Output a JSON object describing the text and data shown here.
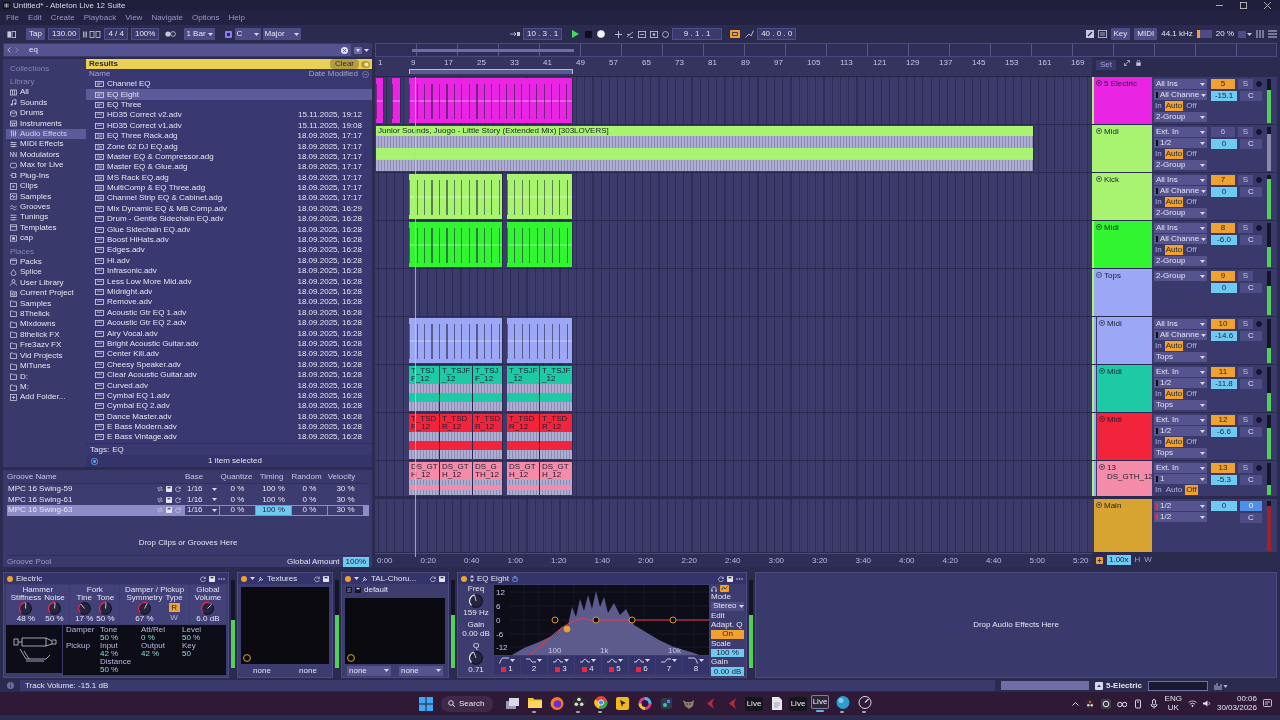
{
  "window": {
    "title": "Untitled* - Ableton Live 12 Suite"
  },
  "menu": [
    "File",
    "Edit",
    "Create",
    "Playback",
    "View",
    "Navigate",
    "Options",
    "Help"
  ],
  "control_bar": {
    "tap": "Tap",
    "tempo": "130.00",
    "signature": "4 / 4",
    "zoom": "100%",
    "quantization": "1 Bar",
    "key": "C",
    "scale": "Major",
    "position": "10 . 3 . 1",
    "playing": true,
    "loop_start": "9 . 1 . 1",
    "loop_on": true,
    "loop_length": "40 . 0 . 0",
    "key_button": "Key",
    "midi_button": "MIDI",
    "sample_rate": "44.1 kHz",
    "cpu": {
      "reading": "20 %",
      "level": 0.2
    }
  },
  "browser": {
    "search": "eq",
    "sidebar": [
      {
        "heading": "Collections"
      },
      {
        "heading": "Library",
        "items": [
          {
            "label": "All",
            "kind": "grid",
            "selected": false
          },
          {
            "label": "Sounds",
            "kind": "note",
            "selected": false
          },
          {
            "label": "Drums",
            "kind": "drum",
            "selected": false
          },
          {
            "label": "Instruments",
            "kind": "keys",
            "selected": false
          },
          {
            "label": "Audio Effects",
            "kind": "sliders",
            "selected": true
          },
          {
            "label": "MIDI Effects",
            "kind": "midi",
            "selected": false
          },
          {
            "label": "Modulators",
            "kind": "wave",
            "selected": false
          },
          {
            "label": "Max for Live",
            "kind": "m4l",
            "selected": false
          },
          {
            "label": "Plug-Ins",
            "kind": "plug",
            "selected": false
          },
          {
            "label": "Clips",
            "kind": "clip",
            "selected": false
          },
          {
            "label": "Samples",
            "kind": "sample",
            "selected": false
          },
          {
            "label": "Grooves",
            "kind": "groove",
            "selected": false
          },
          {
            "label": "Tunings",
            "kind": "tuning",
            "selected": false
          },
          {
            "label": "Templates",
            "kind": "template",
            "selected": false
          },
          {
            "label": "cap",
            "kind": "box",
            "selected": false
          }
        ]
      },
      {
        "heading": "Places",
        "items": [
          {
            "label": "Packs",
            "kind": "pack",
            "selected": false
          },
          {
            "label": "Splice",
            "kind": "splice",
            "selected": false
          },
          {
            "label": "User Library",
            "kind": "user",
            "selected": false
          },
          {
            "label": "Current Project",
            "kind": "project",
            "selected": false
          },
          {
            "label": "Samples",
            "kind": "folder",
            "selected": false
          },
          {
            "label": "8Thelick",
            "kind": "folder",
            "selected": false
          },
          {
            "label": "Mixdowns",
            "kind": "folder",
            "selected": false
          },
          {
            "label": "8thelick FX",
            "kind": "folder",
            "selected": false
          },
          {
            "label": "Fre3azv FX",
            "kind": "folder",
            "selected": false
          },
          {
            "label": "Vid Projects",
            "kind": "folder",
            "selected": false
          },
          {
            "label": "MiTunes",
            "kind": "folder",
            "selected": false
          },
          {
            "label": "D:",
            "kind": "folder",
            "selected": false
          },
          {
            "label": "M:",
            "kind": "folder",
            "selected": false
          },
          {
            "label": "Add Folder...",
            "kind": "add",
            "selected": false
          }
        ]
      }
    ],
    "results": {
      "title": "Results",
      "clear": "Clear",
      "columns": [
        "Name",
        "Date Modified"
      ],
      "rows": [
        {
          "name": "Channel EQ",
          "kind": "device",
          "selected": false
        },
        {
          "name": "EQ Eight",
          "kind": "device",
          "selected": true
        },
        {
          "name": "EQ Three",
          "kind": "device",
          "selected": false
        },
        {
          "name": "HD35 Correct v2.adv",
          "kind": "preset",
          "date": "15.11.2025, 19:12",
          "selected": false
        },
        {
          "name": "HD35 Correct v1.adv",
          "kind": "preset",
          "date": "15.11.2025, 19:08",
          "selected": false
        },
        {
          "name": "EQ Three Rack.adg",
          "kind": "rack",
          "date": "18.09.2025, 17:17",
          "selected": false
        },
        {
          "name": "Zone 62 DJ EQ.adg",
          "kind": "rack",
          "date": "18.09.2025, 17:17",
          "selected": false
        },
        {
          "name": "Master EQ & Compressor.adg",
          "kind": "rack",
          "date": "18.09.2025, 17:17",
          "selected": false
        },
        {
          "name": "Master EQ & Glue.adg",
          "kind": "rack",
          "date": "18.09.2025, 17:17",
          "selected": false
        },
        {
          "name": "MS Rack EQ.adg",
          "kind": "rack",
          "date": "18.09.2025, 17:17",
          "selected": false
        },
        {
          "name": "MultiComp & EQ Three.adg",
          "kind": "rack",
          "date": "18.09.2025, 17:17",
          "selected": false
        },
        {
          "name": "Channel Strip EQ & Cabinet.adg",
          "kind": "rack",
          "date": "18.09.2025, 17:17",
          "selected": false
        },
        {
          "name": "Mix Dynamic EQ & MB Comp.adv",
          "kind": "preset",
          "date": "18.09.2025, 16:29",
          "selected": false
        },
        {
          "name": "Drum - Gentle Sidechain EQ.adv",
          "kind": "preset",
          "date": "18.09.2025, 16:28",
          "selected": false
        },
        {
          "name": "Glue Sidechain EQ.adv",
          "kind": "preset",
          "date": "18.09.2025, 16:28",
          "selected": false
        },
        {
          "name": "Boost HiHats.adv",
          "kind": "preset",
          "date": "18.09.2025, 16:28",
          "selected": false
        },
        {
          "name": "Edges.adv",
          "kind": "preset",
          "date": "18.09.2025, 16:28",
          "selected": false
        },
        {
          "name": "Hi.adv",
          "kind": "preset",
          "date": "18.09.2025, 16:28",
          "selected": false
        },
        {
          "name": "Infrasonic.adv",
          "kind": "preset",
          "date": "18.09.2025, 16:28",
          "selected": false
        },
        {
          "name": "Less Low More Mid.adv",
          "kind": "preset",
          "date": "18.09.2025, 16:28",
          "selected": false
        },
        {
          "name": "Midnight.adv",
          "kind": "preset",
          "date": "18.09.2025, 16:28",
          "selected": false
        },
        {
          "name": "Remove.adv",
          "kind": "preset",
          "date": "18.09.2025, 16:28",
          "selected": false
        },
        {
          "name": "Acoustic Gtr EQ 1.adv",
          "kind": "preset",
          "date": "18.09.2025, 16:28",
          "selected": false
        },
        {
          "name": "Acoustic Gtr EQ 2.adv",
          "kind": "preset",
          "date": "18.09.2025, 16:28",
          "selected": false
        },
        {
          "name": "Airy Vocal.adv",
          "kind": "preset",
          "date": "18.09.2025, 16:28",
          "selected": false
        },
        {
          "name": "Bright Acoustic Guitar.adv",
          "kind": "preset",
          "date": "18.09.2025, 16:28",
          "selected": false
        },
        {
          "name": "Center Kill.adv",
          "kind": "preset",
          "date": "18.09.2025, 16:28",
          "selected": false
        },
        {
          "name": "Cheesy Speaker.adv",
          "kind": "preset",
          "date": "18.09.2025, 16:28",
          "selected": false
        },
        {
          "name": "Clear Acoustic Guitar.adv",
          "kind": "preset",
          "date": "18.09.2025, 16:28",
          "selected": false
        },
        {
          "name": "Curved.adv",
          "kind": "preset",
          "date": "18.09.2025, 16:28",
          "selected": false
        },
        {
          "name": "Cymbal EQ 1.adv",
          "kind": "preset",
          "date": "18.09.2025, 16:28",
          "selected": false
        },
        {
          "name": "Cymbal EQ 2.adv",
          "kind": "preset",
          "date": "18.09.2025, 16:28",
          "selected": false
        },
        {
          "name": "Dance Master.adv",
          "kind": "preset",
          "date": "18.09.2025, 16:28",
          "selected": false
        },
        {
          "name": "E Bass Modern.adv",
          "kind": "preset",
          "date": "18.09.2025, 16:28",
          "selected": false
        },
        {
          "name": "E Bass Vintage.adv",
          "kind": "preset",
          "date": "18.09.2025, 16:28",
          "selected": false
        }
      ],
      "tags_label": "Tags:",
      "tags": "EQ",
      "status": "1 item selected"
    }
  },
  "groove_pool": {
    "columns": [
      "Groove Name",
      "Base",
      "Quantize",
      "Timing",
      "Random",
      "Velocity"
    ],
    "rows": [
      {
        "name": "MPC 16 Swing-59",
        "base": "1/16",
        "quantize": "0 %",
        "timing": "100 %",
        "random": "0 %",
        "velocity": "30 %",
        "selected": false
      },
      {
        "name": "MPC 16 Swing-61",
        "base": "1/16",
        "quantize": "0 %",
        "timing": "100 %",
        "random": "0 %",
        "velocity": "30 %",
        "selected": false
      },
      {
        "name": "MPC 16 Swing-63",
        "base": "1/16",
        "quantize": "0 %",
        "timing": "100 %",
        "random": "0 %",
        "velocity": "30 %",
        "selected": true
      }
    ],
    "drop_hint": "Drop Clips or Grooves Here",
    "title": "Groove Pool",
    "global_amount_label": "Global Amount",
    "global_amount": "100%"
  },
  "arrangement": {
    "ruler": [
      "1",
      "9",
      "17",
      "25",
      "33",
      "41",
      "49",
      "57",
      "65",
      "73",
      "81",
      "89",
      "97",
      "105",
      "113",
      "121",
      "129",
      "137",
      "145",
      "153",
      "161",
      "169"
    ],
    "set_button": "Set",
    "tracks": [
      {
        "name": "5 Electric",
        "color": "#e924e2",
        "kind": "track",
        "input": "All Ins",
        "channel": "All Channe",
        "monitor": [
          {
            "label": "In",
            "selected": false
          },
          {
            "label": "Auto",
            "selected": true
          },
          {
            "label": "Off",
            "selected": false
          }
        ],
        "output": "2-Group",
        "number": "5",
        "active": true,
        "solo": "S",
        "volume": "-15.1",
        "pan": "C",
        "level": 0.75,
        "clips": [
          {
            "kind": "midi"
          },
          {
            "kind": "midi"
          },
          {
            "kind": "midi"
          }
        ]
      },
      {
        "name": "Midi",
        "color": "#a8f36f",
        "kind": "track",
        "input": "Ext. In",
        "channel": "1/2",
        "monitor": [
          {
            "label": "In",
            "selected": false
          },
          {
            "label": "Auto",
            "selected": true
          },
          {
            "label": "Off",
            "selected": false
          }
        ],
        "output": "2-Group",
        "number": "6",
        "active": false,
        "solo": "S",
        "volume": "0",
        "pan": "C",
        "level": 0.85,
        "clips": [
          {
            "kind": "audio",
            "name": "Junior Sounds, Juogo - Little Story (Extended Mix) [303LOVERS]"
          }
        ]
      },
      {
        "name": "Kick",
        "color": "#a8f36f",
        "kind": "track",
        "input": "All Ins",
        "channel": "All Channe",
        "monitor": [
          {
            "label": "In",
            "selected": false
          },
          {
            "label": "Auto",
            "selected": true
          },
          {
            "label": "Off",
            "selected": false
          }
        ],
        "output": "2-Group",
        "number": "7",
        "active": true,
        "solo": "S",
        "volume": "0",
        "pan": "C",
        "level": 0.9,
        "clips": [
          {
            "kind": "midi"
          },
          {
            "kind": "midi"
          }
        ]
      },
      {
        "name": "Midi",
        "color": "#30f530",
        "kind": "track",
        "input": "All Ins",
        "channel": "All Channe",
        "monitor": [
          {
            "label": "In",
            "selected": false
          },
          {
            "label": "Auto",
            "selected": true
          },
          {
            "label": "Off",
            "selected": false
          }
        ],
        "output": "2-Group",
        "number": "8",
        "active": true,
        "solo": "S",
        "volume": "-6.0",
        "pan": "C",
        "level": 0.45,
        "clips": [
          {
            "kind": "midi"
          },
          {
            "kind": "midi"
          }
        ]
      },
      {
        "name": "Tops",
        "color": "#9ca7f6",
        "kind": "group",
        "output": "2-Group",
        "number": "9",
        "active": true,
        "solo": "S",
        "volume": "0",
        "pan": "C",
        "level": 0.65,
        "children": [
          {
            "name": "Midi",
            "color": "#9ca7f6",
            "kind": "track",
            "input": "All Ins",
            "channel": "All Channe",
            "monitor": [
              {
                "label": "In",
                "selected": false
              },
              {
                "label": "Auto",
                "selected": true
              },
              {
                "label": "Off",
                "selected": false
              }
            ],
            "output": "Tops",
            "number": "10",
            "active": true,
            "solo": "S",
            "volume": "-14.6",
            "pan": "C",
            "level": 0.35,
            "clips": [
              {
                "kind": "midi"
              },
              {
                "kind": "midi"
              }
            ]
          },
          {
            "name": "Midi",
            "color": "#1ec9a6",
            "kind": "track",
            "input": "Ext. In",
            "channel": "1/2",
            "monitor": [
              {
                "label": "In",
                "selected": false
              },
              {
                "label": "Auto",
                "selected": true
              },
              {
                "label": "Off",
                "selected": false
              }
            ],
            "output": "Tops",
            "number": "11",
            "active": true,
            "solo": "S",
            "volume": "-11.8",
            "pan": "C",
            "level": 0.4,
            "clips": [
              {
                "kind": "audio",
                "name": "T_TSJF_12"
              },
              {
                "kind": "audio",
                "name": "T_TSJF_12"
              },
              {
                "kind": "audio",
                "name": "T_TSJF_12"
              },
              {
                "kind": "audio",
                "name": "T_TSJF_12"
              },
              {
                "kind": "audio",
                "name": "T_TSJF_12"
              }
            ]
          },
          {
            "name": "Midi",
            "color": "#f1243c",
            "kind": "track",
            "input": "Ext. In",
            "channel": "1/2",
            "monitor": [
              {
                "label": "In",
                "selected": false
              },
              {
                "label": "Auto",
                "selected": true
              },
              {
                "label": "Off",
                "selected": false
              }
            ],
            "output": "Tops",
            "number": "12",
            "active": true,
            "solo": "S",
            "volume": "-6.6",
            "pan": "C",
            "level": 0.7,
            "clips": [
              {
                "kind": "audio",
                "name": "T_TSDR_12"
              },
              {
                "kind": "audio",
                "name": "T_TSDR_12"
              },
              {
                "kind": "audio",
                "name": "T_TSDR_12"
              },
              {
                "kind": "audio",
                "name": "T_TSDR_12"
              },
              {
                "kind": "audio",
                "name": "T_TSDR_12"
              }
            ]
          },
          {
            "name": "13 DS_GTH_12",
            "color": "#f38ba9",
            "kind": "track",
            "input": "Ext. In",
            "channel": "1",
            "monitor": [
              {
                "label": "In",
                "selected": false
              },
              {
                "label": "Auto",
                "selected": false
              },
              {
                "label": "Off",
                "selected": true
              }
            ],
            "number": "13",
            "active": true,
            "solo": "S",
            "volume": "-5.3",
            "pan": "C",
            "level": 0.3,
            "clips": [
              {
                "kind": "audio",
                "name": "DS_GTH_12"
              },
              {
                "kind": "audio",
                "name": "DS_GTH_12"
              },
              {
                "kind": "audio",
                "name": "DS_GTH_12"
              },
              {
                "kind": "audio",
                "name": "DS_GTH_12"
              },
              {
                "kind": "audio",
                "name": "DS_GTH_12"
              }
            ]
          }
        ]
      }
    ],
    "main": {
      "name": "Main",
      "color": "#d7a331",
      "inputs": [
        "1/2",
        "1/2"
      ],
      "volume": "0",
      "cue": "0",
      "pan": "C",
      "level": 0.9
    },
    "time_ruler": [
      "0:00",
      "0:20",
      "0:40",
      "1:00",
      "1:20",
      "1:40",
      "2:00",
      "2:20",
      "2:40",
      "3:00",
      "3:20",
      "3:40",
      "4:00",
      "4:20",
      "4:40",
      "5:00",
      "5:20"
    ],
    "zoom_readout": "1.00x",
    "height_label": "H",
    "width_label": "W"
  },
  "devices": [
    {
      "kind": "electric",
      "name": "Electric",
      "on": true,
      "level": 0.55,
      "sections": [
        {
          "title": "Hammer",
          "knobs": [
            {
              "label": "Stiffness",
              "value": "48 %",
              "level": 0.48
            },
            {
              "label": "Noise",
              "value": "50 %",
              "level": 0.5
            }
          ]
        },
        {
          "title": "Fork",
          "knobs": [
            {
              "label": "Tine",
              "value": "17 %",
              "level": 0.17
            },
            {
              "label": "Tone",
              "value": "50 %",
              "level": 0.5
            }
          ]
        },
        {
          "title": "Damper / Pickup",
          "knobs": [
            {
              "label": "Symmetry",
              "value": "67 %",
              "level": 0.67
            }
          ],
          "type_label": "Type",
          "type_options": [
            {
              "label": "R",
              "selected": true
            },
            {
              "label": "W",
              "selected": false
            }
          ]
        },
        {
          "title": "Global",
          "knobs": [
            {
              "label": "Volume",
              "value": "6.0 dB",
              "level": 0.78
            }
          ]
        }
      ],
      "params": [
        {
          "group": "Damper",
          "items": [
            {
              "label": "Tone",
              "value": "50 %"
            },
            {
              "label": "Att/Rel",
              "value": "0 %"
            },
            {
              "label": "Level",
              "value": "50 %"
            }
          ]
        },
        {
          "group": "Pickup",
          "items": [
            {
              "label": "Input",
              "value": "42 %"
            },
            {
              "label": "Output",
              "value": "42 %"
            },
            {
              "label": "Key",
              "value": "50"
            },
            {
              "label": "Distance",
              "value": "50 %"
            }
          ]
        }
      ]
    },
    {
      "kind": "xy",
      "name": "Textures",
      "on": true,
      "level": 0.6,
      "dropdowns": false,
      "x_param": "none",
      "y_param": "none"
    },
    {
      "kind": "xy",
      "name": "TAL-Choru...",
      "on": true,
      "level": 0.6,
      "preset": "default",
      "dropdowns": true,
      "x_param": "none",
      "y_param": "none"
    },
    {
      "kind": "eq",
      "name": "EQ Eight",
      "on": true,
      "level": 0.6,
      "freq": {
        "label": "Freq",
        "value": "159 Hz",
        "level": 0.35
      },
      "gain": {
        "label": "Gain",
        "value": "0.00 dB"
      },
      "q": {
        "label": "Q",
        "value": "0.71",
        "level": 0.3
      },
      "yticks": [
        "12",
        "6",
        "0",
        "-6",
        "-12"
      ],
      "xticks": [
        "100",
        "1k",
        "10k"
      ],
      "bands": [
        {
          "number": "1",
          "kind": "lowcut",
          "on": true
        },
        {
          "number": "2",
          "kind": "lowshelf",
          "on": false
        },
        {
          "number": "3",
          "kind": "bell",
          "on": true
        },
        {
          "number": "4",
          "kind": "bell",
          "on": true
        },
        {
          "number": "5",
          "kind": "bell",
          "on": true
        },
        {
          "number": "6",
          "kind": "bell",
          "on": true
        },
        {
          "number": "7",
          "kind": "highshelf",
          "on": false
        },
        {
          "number": "8",
          "kind": "highcut",
          "on": false
        }
      ],
      "mode_label": "Mode",
      "mode": "Stereo",
      "edit": "Edit",
      "adaptive_q": {
        "label": "Adapt. Q",
        "value": "On",
        "on": true
      },
      "scale_label": "Scale",
      "scale": "100 %",
      "out_gain_label": "Gain",
      "out_gain": "0.00 dB"
    }
  ],
  "device_drop_hint": "Drop Audio Effects Here",
  "status_bar": {
    "message": "Track Volume: -15.1 dB",
    "track": "5-Electric"
  },
  "taskbar": {
    "search": "Search",
    "apps": [
      {
        "kind": "taskview",
        "running": false,
        "selected": false
      },
      {
        "kind": "folder",
        "running": true,
        "selected": false
      },
      {
        "kind": "fox",
        "running": false,
        "selected": false
      },
      {
        "kind": "aperture",
        "running": true,
        "selected": false
      },
      {
        "kind": "wheel",
        "running": true,
        "selected": false
      },
      {
        "kind": "cursor",
        "running": false,
        "selected": false
      },
      {
        "kind": "ring",
        "running": false,
        "selected": false
      },
      {
        "kind": "tile",
        "running": false,
        "selected": false
      },
      {
        "kind": "animal",
        "running": false,
        "selected": false
      },
      {
        "kind": "arrow",
        "running": false,
        "selected": false
      },
      {
        "kind": "arrow",
        "running": false,
        "selected": false
      },
      {
        "kind": "live",
        "label": "Live",
        "running": false,
        "selected": false
      },
      {
        "kind": "doc",
        "running": false,
        "selected": false
      },
      {
        "kind": "live",
        "label": "Live",
        "running": false,
        "selected": false
      },
      {
        "kind": "live",
        "label": "Live",
        "running": true,
        "selected": true
      },
      {
        "kind": "sphere",
        "running": true,
        "selected": false
      },
      {
        "kind": "gauge",
        "running": true,
        "selected": false
      }
    ],
    "tray_icons": [
      {
        "kind": "aperture"
      },
      {
        "kind": "square"
      },
      {
        "kind": "loops"
      },
      {
        "kind": "drive"
      },
      {
        "kind": "mic"
      }
    ],
    "language": "ENG",
    "region": "UK",
    "time": "00:06",
    "date": "30/03/2026"
  }
}
